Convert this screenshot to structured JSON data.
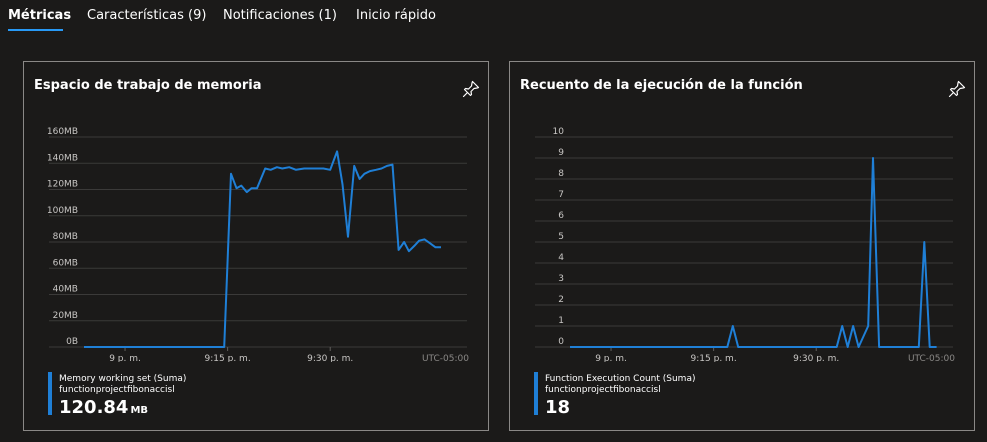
{
  "tabs": [
    {
      "label": "Métricas",
      "active": true
    },
    {
      "label": "Características (9)",
      "active": false
    },
    {
      "label": "Notificaciones (1)",
      "active": false
    },
    {
      "label": "Inicio rápido",
      "active": false
    }
  ],
  "colors": {
    "accent": "#2899f5",
    "series": "#1f7fd6",
    "border": "#8a8886",
    "background": "#1b1a19"
  },
  "cards": [
    {
      "title": "Espacio de trabajo de memoria",
      "pin_icon": "pin-icon",
      "timezone": "UTC-05:00",
      "legend": {
        "name": "Memory working set (Suma)",
        "resource": "functionprojectfibonaccisl",
        "value": "120.84",
        "unit": "MB"
      }
    },
    {
      "title": "Recuento de la ejecución de la función",
      "pin_icon": "pin-icon",
      "timezone": "UTC-05:00",
      "legend": {
        "name": "Function Execution Count (Suma)",
        "resource": "functionprojectfibonaccisl",
        "value": "18",
        "unit": ""
      }
    }
  ],
  "chart_data": [
    {
      "type": "line",
      "title": "Espacio de trabajo de memoria",
      "ylim": [
        0,
        160
      ],
      "yticks": [
        0,
        20,
        40,
        60,
        80,
        100,
        120,
        140,
        160
      ],
      "ytick_labels": [
        "0B",
        "20MB",
        "40MB",
        "60MB",
        "80MB",
        "100MB",
        "120MB",
        "140MB",
        "160MB"
      ],
      "xlim": [
        0,
        56
      ],
      "xticks": [
        6,
        21,
        36
      ],
      "xtick_labels": [
        "9 p. m.",
        "9:15 p. m.",
        "9:30 p. m."
      ],
      "grid": true,
      "series": [
        {
          "name": "Memory working set (Suma)",
          "x": [
            0,
            20.5,
            21.5,
            22.3,
            23,
            23.8,
            24.5,
            25.3,
            26.5,
            27.3,
            28.2,
            29,
            30,
            31,
            32.2,
            33,
            34,
            35,
            36,
            37,
            37.8,
            38.6,
            39.5,
            40.3,
            41,
            41.8,
            42.7,
            43.5,
            44.3,
            45.1,
            46,
            46.8,
            47.5,
            48.3,
            49,
            49.8,
            50.6,
            51.4,
            52.2
          ],
          "y": [
            0,
            0,
            132,
            121,
            123,
            118,
            121,
            121,
            136,
            135,
            137,
            136,
            137,
            135,
            136,
            136,
            136,
            136,
            135,
            149,
            124,
            84,
            138,
            128,
            132,
            134,
            135,
            136,
            138,
            139,
            74,
            80,
            73,
            77,
            81,
            82,
            79,
            76,
            76
          ]
        }
      ]
    },
    {
      "type": "line",
      "title": "Recuento de la ejecución de la función",
      "ylim": [
        0,
        10
      ],
      "yticks": [
        0,
        1,
        2,
        3,
        4,
        5,
        6,
        7,
        8,
        9,
        10
      ],
      "ytick_labels": [
        "0",
        "1",
        "2",
        "3",
        "4",
        "5",
        "6",
        "7",
        "8",
        "9",
        "10"
      ],
      "xlim": [
        0,
        56
      ],
      "xticks": [
        6,
        21,
        36
      ],
      "xtick_labels": [
        "9 p. m.",
        "9:15 p. m.",
        "9:30 p. m."
      ],
      "grid": true,
      "series": [
        {
          "name": "Function Execution Count (Suma)",
          "x": [
            0,
            23,
            23.8,
            24.6,
            39,
            39.8,
            40.6,
            41.4,
            42.2,
            43.6,
            44.3,
            45.2,
            51,
            51.8,
            52.6,
            53.6
          ],
          "y": [
            0,
            0,
            1,
            0,
            0,
            1,
            0,
            1,
            0,
            1,
            9,
            0,
            0,
            5,
            0,
            0
          ]
        }
      ]
    }
  ]
}
